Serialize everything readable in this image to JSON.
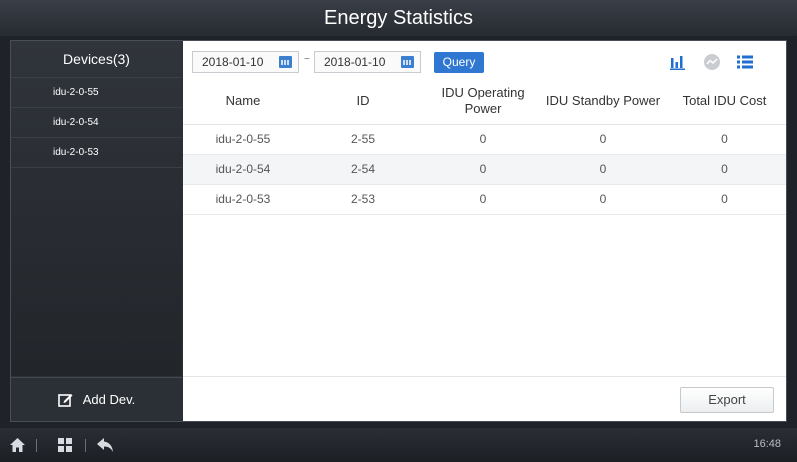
{
  "window": {
    "title": "Energy Statistics"
  },
  "sidebar": {
    "header": "Devices(3)",
    "devices": [
      {
        "label": "idu-2-0-55"
      },
      {
        "label": "idu-2-0-54"
      },
      {
        "label": "idu-2-0-53"
      }
    ],
    "add_label": "Add Dev."
  },
  "toolbar": {
    "start_date": "2018-01-10",
    "separator": "~",
    "end_date": "2018-01-10",
    "query_label": "Query",
    "view_icons": [
      "bar-chart-icon",
      "line-chart-icon",
      "list-icon"
    ]
  },
  "table": {
    "headers": [
      "Name",
      "ID",
      "IDU Operating Power",
      "IDU Standby Power",
      "Total IDU Cost"
    ],
    "rows": [
      [
        "idu-2-0-55",
        "2-55",
        "0",
        "0",
        "0"
      ],
      [
        "idu-2-0-54",
        "2-54",
        "0",
        "0",
        "0"
      ],
      [
        "idu-2-0-53",
        "2-53",
        "0",
        "0",
        "0"
      ]
    ]
  },
  "export_label": "Export",
  "footer": {
    "icons": [
      "home-icon",
      "grid-icon",
      "back-icon"
    ],
    "time": "16:48"
  },
  "colors": {
    "accent": "#2f77d0",
    "sidebar_bg": "#2c3037",
    "icon_blue": "#1e6fd1"
  }
}
